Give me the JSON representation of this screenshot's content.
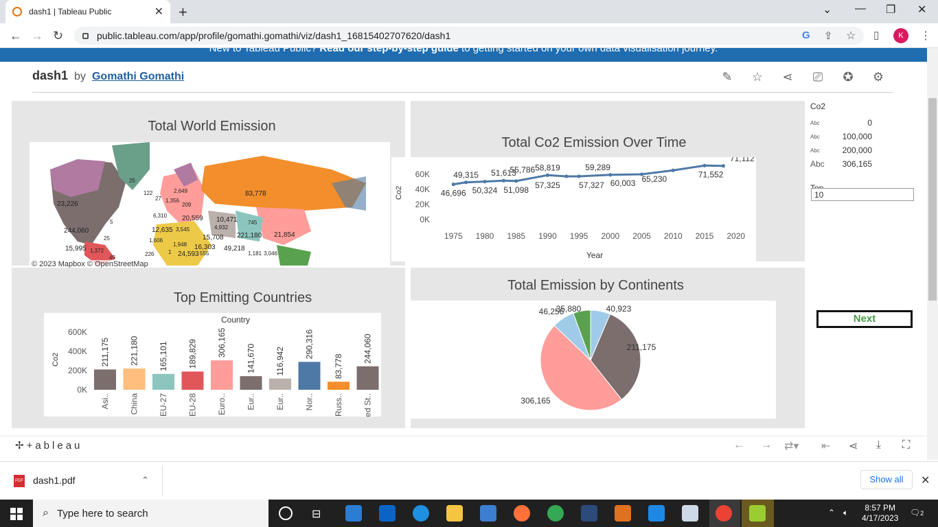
{
  "browser": {
    "tab_title": "dash1 | Tableau Public",
    "url": "public.tableau.com/app/profile/gomathi.gomathi/viz/dash1_16815402707620/dash1",
    "avatar": "K"
  },
  "banner": {
    "prefix": "New to Tableau Public? ",
    "link": "Read our step-by-step guide",
    "suffix": " to getting started on your own data visualisation journey."
  },
  "viz": {
    "title": "dash1",
    "by": "by",
    "author": "Gomathi Gomathi"
  },
  "panels": {
    "map_title": "Total World Emission",
    "map_credit": "© 2023 Mapbox  © OpenStreetMap",
    "line_title": "Total Co2 Emission Over Time",
    "bar_title": "Top Emitting Countries",
    "pie_title": "Total Emission by Continents"
  },
  "legend": {
    "title": "Co2",
    "items": [
      {
        "tag": "Abc",
        "value": "0"
      },
      {
        "tag": "Abc",
        "value": "100,000"
      },
      {
        "tag": "Abc",
        "value": "200,000"
      },
      {
        "tag": "Abc",
        "value": "306,165"
      }
    ],
    "top_label": "Top",
    "top_value": "10",
    "next_label": "Next"
  },
  "map_labels": [
    "25",
    "23,226",
    "244,060",
    "25",
    "15,995",
    "1,372",
    "49",
    "122",
    "27",
    "1,356",
    "2,649",
    "209",
    "6,310",
    "20,559",
    "12,635",
    "3,545",
    "1,606",
    "1,948",
    "226",
    "10,471",
    "4,932",
    "15,708",
    "16,303",
    "555",
    "745",
    "221,180",
    "21,854",
    "83,778",
    "49,218",
    "3,046",
    "24,593",
    "1,181",
    "1",
    "5"
  ],
  "chart_data": [
    {
      "type": "line",
      "title": "Total Co2 Emission Over Time",
      "xlabel": "Year",
      "ylabel": "Co2",
      "x_ticks": [
        "1975",
        "1980",
        "1985",
        "1990",
        "1995",
        "2000",
        "2005",
        "2010",
        "2015",
        "2020"
      ],
      "y_ticks": [
        "60K",
        "40K",
        "20K",
        "0K"
      ],
      "x": [
        1975,
        1977,
        1980,
        1983,
        1985,
        1990,
        1993,
        1995,
        2000,
        2005,
        2010,
        2015,
        2018
      ],
      "y": [
        46696,
        49315,
        50324,
        51613,
        51098,
        58819,
        57325,
        57327,
        59289,
        60003,
        65230,
        71552,
        71112
      ],
      "point_labels": [
        {
          "x": 1975,
          "y": 46696,
          "label": "46,696",
          "below": true
        },
        {
          "x": 1977,
          "y": 49315,
          "label": "49,315",
          "below": false
        },
        {
          "x": 1980,
          "y": 50324,
          "label": "50,324",
          "below": true
        },
        {
          "x": 1983,
          "y": 51613,
          "label": "51,613",
          "below": false
        },
        {
          "x": 1985,
          "y": 51098,
          "label": "51,098",
          "below": true
        },
        {
          "x": 1986,
          "y": 55786,
          "label": "55,786",
          "below": false
        },
        {
          "x": 1990,
          "y": 58819,
          "label": "58,819",
          "below": false
        },
        {
          "x": 1990,
          "y": 57325,
          "label": "57,325",
          "below": true
        },
        {
          "x": 1997,
          "y": 57327,
          "label": "57,327",
          "below": true
        },
        {
          "x": 1998,
          "y": 59289,
          "label": "59,289",
          "below": false
        },
        {
          "x": 2002,
          "y": 60003,
          "label": "60,003",
          "below": true
        },
        {
          "x": 2007,
          "y": 65230,
          "label": "65,230",
          "below": true
        },
        {
          "x": 2016,
          "y": 71552,
          "label": "71,552",
          "below": true
        },
        {
          "x": 2021,
          "y": 71112,
          "label": "71,112",
          "below": false
        }
      ],
      "ylim": [
        0,
        70000
      ],
      "color": "#4e79a7"
    },
    {
      "type": "bar",
      "title": "Top Emitting Countries",
      "xlabel": "Country",
      "ylabel": "Co2",
      "categories": [
        "Asi..",
        "China",
        "EU-27",
        "EU-28",
        "Euro..",
        "Eur..",
        "Eur..",
        "Nor..",
        "Russ..",
        "United St.."
      ],
      "values": [
        211175,
        221180,
        165101,
        189829,
        306165,
        141670,
        116942,
        290316,
        83778,
        244060
      ],
      "value_labels": [
        "211,175",
        "221,180",
        "165,101",
        "189,829",
        "306,165",
        "141,670",
        "116,942",
        "290,316",
        "83,778",
        "244,060"
      ],
      "colors": [
        "#7b6e6c",
        "#ffbe7d",
        "#8cc5bd",
        "#e15759",
        "#ff9d9a",
        "#7b6e6c",
        "#bab0ac",
        "#4e79a7",
        "#f28e2b",
        "#7b6e6c"
      ],
      "y_ticks": [
        "600K",
        "400K",
        "200K",
        "0K"
      ],
      "ylim": [
        0,
        600000
      ]
    },
    {
      "type": "pie",
      "title": "Total Emission by Continents",
      "values": [
        40923,
        211175,
        306165,
        46256,
        35880
      ],
      "labels": [
        "40,923",
        "211,175",
        "306,165",
        "46,256",
        "35,880"
      ],
      "colors": [
        "#a0cbe8",
        "#7b6e6c",
        "#ff9d9a",
        "#a0cbe8",
        "#59a14f"
      ]
    }
  ],
  "footer": {
    "logo": "+ableau"
  },
  "download": {
    "file": "dash1.pdf",
    "show_all": "Show all"
  },
  "taskbar": {
    "search_placeholder": "Type here to search",
    "time": "8:57 PM",
    "date": "4/17/2023",
    "notif": "2"
  }
}
